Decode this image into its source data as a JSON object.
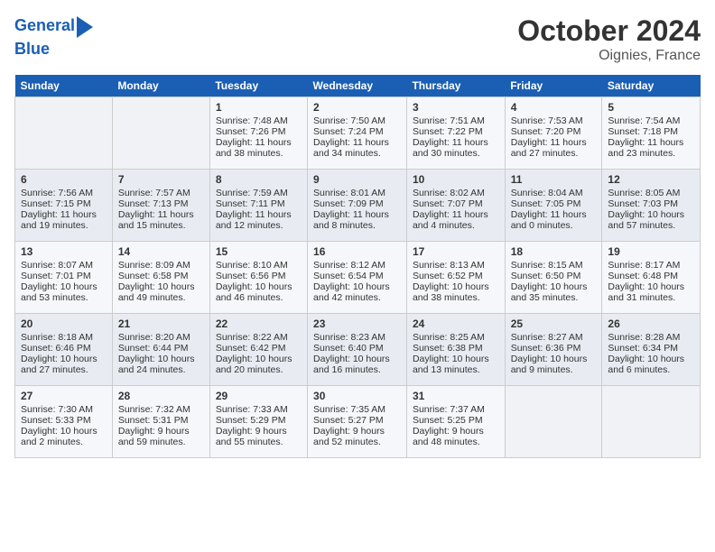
{
  "header": {
    "logo_line1": "General",
    "logo_line2": "Blue",
    "month": "October 2024",
    "location": "Oignies, France"
  },
  "days_of_week": [
    "Sunday",
    "Monday",
    "Tuesday",
    "Wednesday",
    "Thursday",
    "Friday",
    "Saturday"
  ],
  "weeks": [
    [
      {
        "day": "",
        "empty": true
      },
      {
        "day": "",
        "empty": true
      },
      {
        "day": "1",
        "sunrise": "Sunrise: 7:48 AM",
        "sunset": "Sunset: 7:26 PM",
        "daylight": "Daylight: 11 hours and 38 minutes."
      },
      {
        "day": "2",
        "sunrise": "Sunrise: 7:50 AM",
        "sunset": "Sunset: 7:24 PM",
        "daylight": "Daylight: 11 hours and 34 minutes."
      },
      {
        "day": "3",
        "sunrise": "Sunrise: 7:51 AM",
        "sunset": "Sunset: 7:22 PM",
        "daylight": "Daylight: 11 hours and 30 minutes."
      },
      {
        "day": "4",
        "sunrise": "Sunrise: 7:53 AM",
        "sunset": "Sunset: 7:20 PM",
        "daylight": "Daylight: 11 hours and 27 minutes."
      },
      {
        "day": "5",
        "sunrise": "Sunrise: 7:54 AM",
        "sunset": "Sunset: 7:18 PM",
        "daylight": "Daylight: 11 hours and 23 minutes."
      }
    ],
    [
      {
        "day": "6",
        "sunrise": "Sunrise: 7:56 AM",
        "sunset": "Sunset: 7:15 PM",
        "daylight": "Daylight: 11 hours and 19 minutes."
      },
      {
        "day": "7",
        "sunrise": "Sunrise: 7:57 AM",
        "sunset": "Sunset: 7:13 PM",
        "daylight": "Daylight: 11 hours and 15 minutes."
      },
      {
        "day": "8",
        "sunrise": "Sunrise: 7:59 AM",
        "sunset": "Sunset: 7:11 PM",
        "daylight": "Daylight: 11 hours and 12 minutes."
      },
      {
        "day": "9",
        "sunrise": "Sunrise: 8:01 AM",
        "sunset": "Sunset: 7:09 PM",
        "daylight": "Daylight: 11 hours and 8 minutes."
      },
      {
        "day": "10",
        "sunrise": "Sunrise: 8:02 AM",
        "sunset": "Sunset: 7:07 PM",
        "daylight": "Daylight: 11 hours and 4 minutes."
      },
      {
        "day": "11",
        "sunrise": "Sunrise: 8:04 AM",
        "sunset": "Sunset: 7:05 PM",
        "daylight": "Daylight: 11 hours and 0 minutes."
      },
      {
        "day": "12",
        "sunrise": "Sunrise: 8:05 AM",
        "sunset": "Sunset: 7:03 PM",
        "daylight": "Daylight: 10 hours and 57 minutes."
      }
    ],
    [
      {
        "day": "13",
        "sunrise": "Sunrise: 8:07 AM",
        "sunset": "Sunset: 7:01 PM",
        "daylight": "Daylight: 10 hours and 53 minutes."
      },
      {
        "day": "14",
        "sunrise": "Sunrise: 8:09 AM",
        "sunset": "Sunset: 6:58 PM",
        "daylight": "Daylight: 10 hours and 49 minutes."
      },
      {
        "day": "15",
        "sunrise": "Sunrise: 8:10 AM",
        "sunset": "Sunset: 6:56 PM",
        "daylight": "Daylight: 10 hours and 46 minutes."
      },
      {
        "day": "16",
        "sunrise": "Sunrise: 8:12 AM",
        "sunset": "Sunset: 6:54 PM",
        "daylight": "Daylight: 10 hours and 42 minutes."
      },
      {
        "day": "17",
        "sunrise": "Sunrise: 8:13 AM",
        "sunset": "Sunset: 6:52 PM",
        "daylight": "Daylight: 10 hours and 38 minutes."
      },
      {
        "day": "18",
        "sunrise": "Sunrise: 8:15 AM",
        "sunset": "Sunset: 6:50 PM",
        "daylight": "Daylight: 10 hours and 35 minutes."
      },
      {
        "day": "19",
        "sunrise": "Sunrise: 8:17 AM",
        "sunset": "Sunset: 6:48 PM",
        "daylight": "Daylight: 10 hours and 31 minutes."
      }
    ],
    [
      {
        "day": "20",
        "sunrise": "Sunrise: 8:18 AM",
        "sunset": "Sunset: 6:46 PM",
        "daylight": "Daylight: 10 hours and 27 minutes."
      },
      {
        "day": "21",
        "sunrise": "Sunrise: 8:20 AM",
        "sunset": "Sunset: 6:44 PM",
        "daylight": "Daylight: 10 hours and 24 minutes."
      },
      {
        "day": "22",
        "sunrise": "Sunrise: 8:22 AM",
        "sunset": "Sunset: 6:42 PM",
        "daylight": "Daylight: 10 hours and 20 minutes."
      },
      {
        "day": "23",
        "sunrise": "Sunrise: 8:23 AM",
        "sunset": "Sunset: 6:40 PM",
        "daylight": "Daylight: 10 hours and 16 minutes."
      },
      {
        "day": "24",
        "sunrise": "Sunrise: 8:25 AM",
        "sunset": "Sunset: 6:38 PM",
        "daylight": "Daylight: 10 hours and 13 minutes."
      },
      {
        "day": "25",
        "sunrise": "Sunrise: 8:27 AM",
        "sunset": "Sunset: 6:36 PM",
        "daylight": "Daylight: 10 hours and 9 minutes."
      },
      {
        "day": "26",
        "sunrise": "Sunrise: 8:28 AM",
        "sunset": "Sunset: 6:34 PM",
        "daylight": "Daylight: 10 hours and 6 minutes."
      }
    ],
    [
      {
        "day": "27",
        "sunrise": "Sunrise: 7:30 AM",
        "sunset": "Sunset: 5:33 PM",
        "daylight": "Daylight: 10 hours and 2 minutes."
      },
      {
        "day": "28",
        "sunrise": "Sunrise: 7:32 AM",
        "sunset": "Sunset: 5:31 PM",
        "daylight": "Daylight: 9 hours and 59 minutes."
      },
      {
        "day": "29",
        "sunrise": "Sunrise: 7:33 AM",
        "sunset": "Sunset: 5:29 PM",
        "daylight": "Daylight: 9 hours and 55 minutes."
      },
      {
        "day": "30",
        "sunrise": "Sunrise: 7:35 AM",
        "sunset": "Sunset: 5:27 PM",
        "daylight": "Daylight: 9 hours and 52 minutes."
      },
      {
        "day": "31",
        "sunrise": "Sunrise: 7:37 AM",
        "sunset": "Sunset: 5:25 PM",
        "daylight": "Daylight: 9 hours and 48 minutes."
      },
      {
        "day": "",
        "empty": true
      },
      {
        "day": "",
        "empty": true
      }
    ]
  ]
}
